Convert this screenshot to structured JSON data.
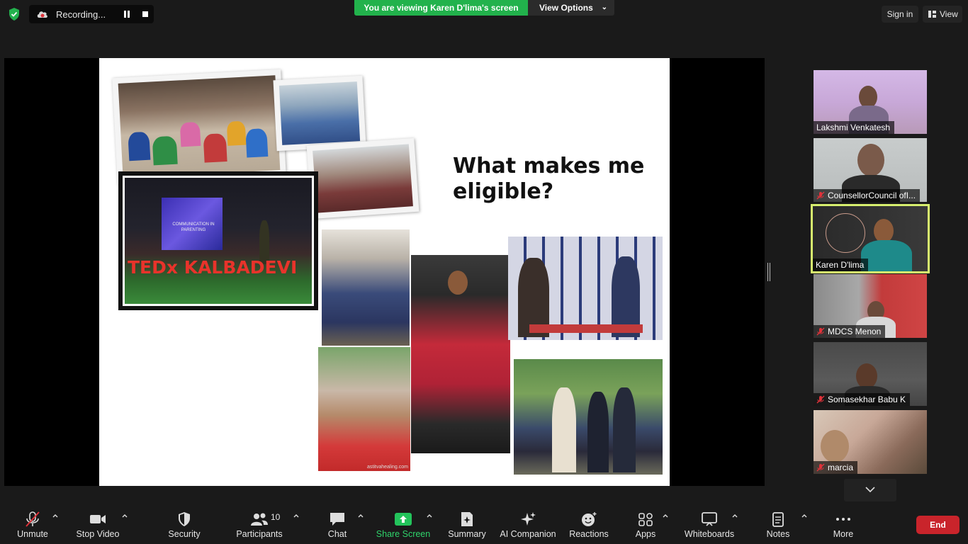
{
  "top_bar": {
    "recording_label": "Recording...",
    "viewing_banner": "You are viewing Karen D'lima's screen",
    "view_options_label": "View Options",
    "sign_in_label": "Sign in",
    "view_label": "View"
  },
  "slide": {
    "title": "What makes me eligible?",
    "photo_banner_text": "TEDx KALBADEVI",
    "projected_text": "COMMUNICATION IN PARENTING",
    "watermark": "astitvahealing.com"
  },
  "participants": [
    {
      "name": "Lakshmi Venkatesh",
      "muted": false
    },
    {
      "name": "CounsellorCouncil ofI...",
      "muted": true
    },
    {
      "name": "Karen D'lima",
      "muted": false,
      "active": true
    },
    {
      "name": "MDCS Menon",
      "muted": true
    },
    {
      "name": "Somasekhar Babu K",
      "muted": true
    },
    {
      "name": "marcia",
      "muted": true
    }
  ],
  "toolbar": {
    "unmute": "Unmute",
    "stop_video": "Stop Video",
    "security": "Security",
    "participants": "Participants",
    "participants_count": "10",
    "chat": "Chat",
    "share_screen": "Share Screen",
    "summary": "Summary",
    "ai_companion": "AI Companion",
    "reactions": "Reactions",
    "apps": "Apps",
    "whiteboards": "Whiteboards",
    "notes": "Notes",
    "more": "More",
    "end": "End"
  },
  "colors": {
    "banner_green": "#22b24c",
    "share_green": "#2fd36b",
    "active_speaker_border": "#d7ef6e",
    "end_red": "#c9242b",
    "muted_red": "#e0323a"
  }
}
